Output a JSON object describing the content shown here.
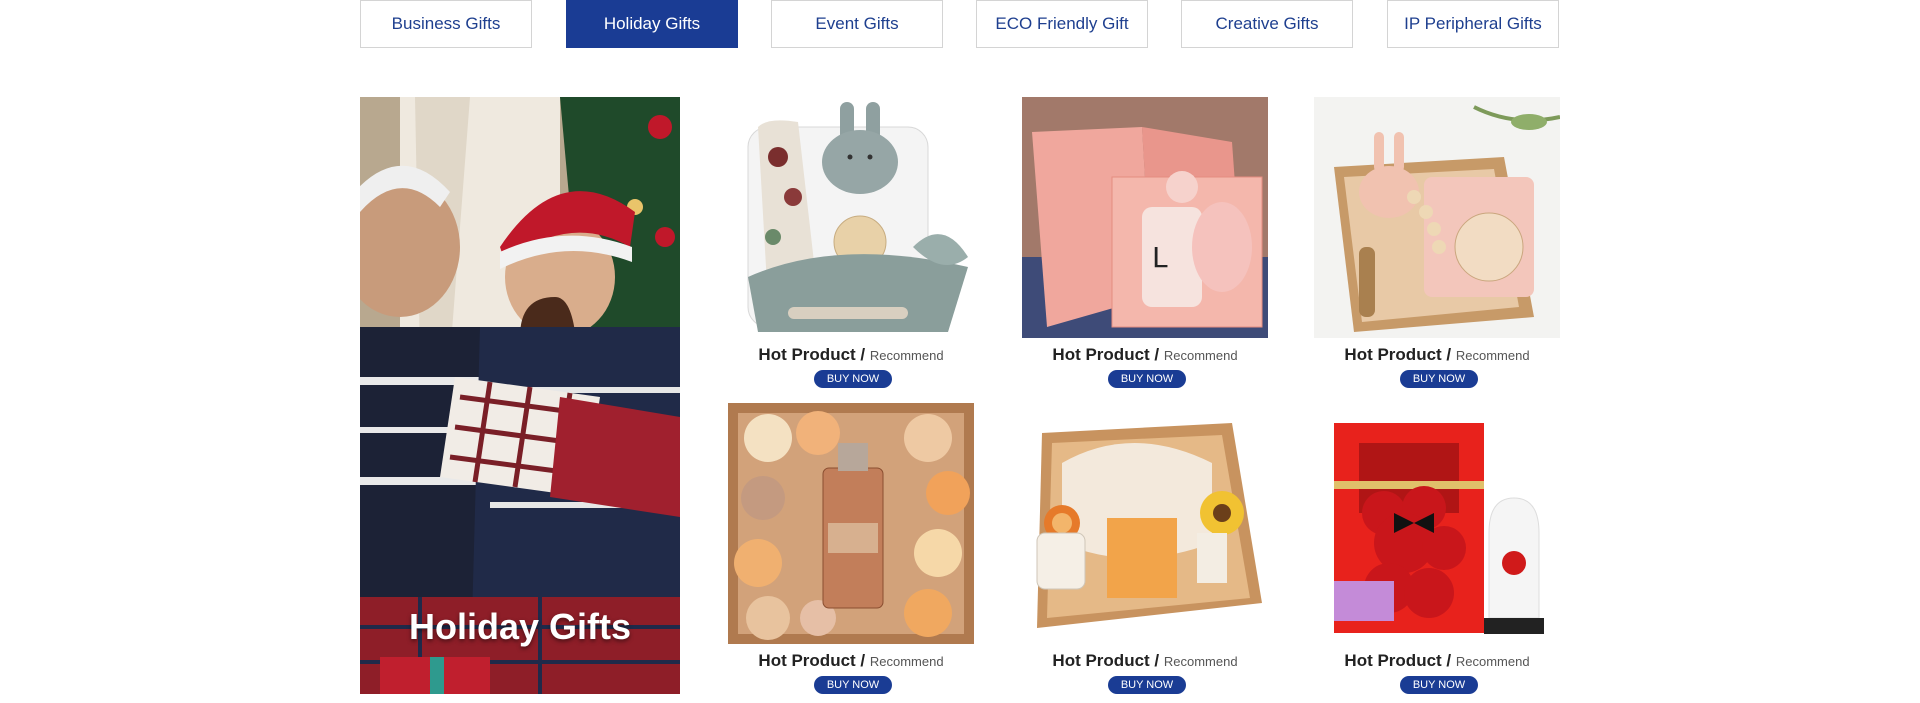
{
  "tabs": [
    {
      "label": "Business Gifts",
      "active": false
    },
    {
      "label": "Holiday Gifts",
      "active": true
    },
    {
      "label": "Event Gifts",
      "active": false
    },
    {
      "label": "ECO Friendly Gift",
      "active": false
    },
    {
      "label": "Creative Gifts",
      "active": false
    },
    {
      "label": "IP Peripheral Gifts",
      "active": false
    }
  ],
  "hero": {
    "title": "Holiday Gifts"
  },
  "products": [
    {
      "title": "Hot Product /",
      "subtitle": "Recommend",
      "button": "BUY NOW",
      "image": "baby-gift-box-bunny-image"
    },
    {
      "title": "Hot Product /",
      "subtitle": "Recommend",
      "button": "BUY NOW",
      "image": "pink-mug-gift-box-image"
    },
    {
      "title": "Hot Product /",
      "subtitle": "Recommend",
      "button": "BUY NOW",
      "image": "baby-keepsake-box-image"
    },
    {
      "title": "Hot Product /",
      "subtitle": "Recommend",
      "button": "BUY NOW",
      "image": "rose-perfume-box-image"
    },
    {
      "title": "Hot Product /",
      "subtitle": "Recommend",
      "button": "BUY NOW",
      "image": "sunflower-spa-box-image"
    },
    {
      "title": "Hot Product /",
      "subtitle": "Recommend",
      "button": "BUY NOW",
      "image": "rose-bear-gift-box-image"
    }
  ],
  "colors": {
    "accent": "#1a3c94",
    "tab_text": "#1e3f8f"
  }
}
